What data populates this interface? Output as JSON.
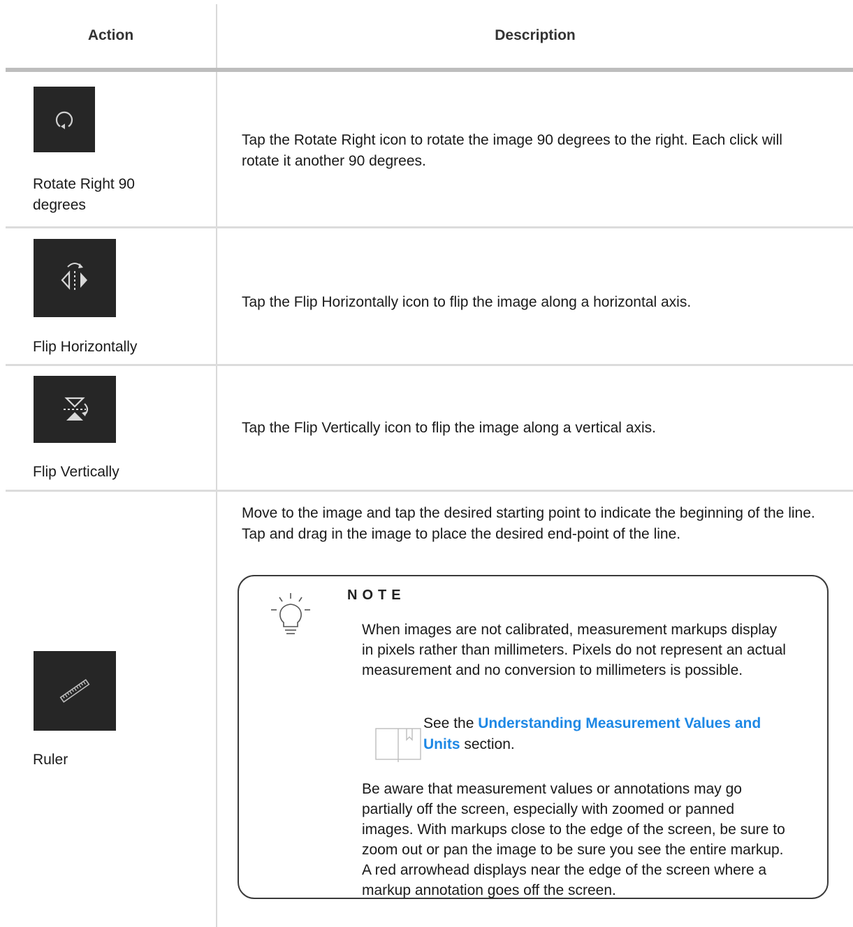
{
  "table": {
    "headers": {
      "action": "Action",
      "description": "Description"
    },
    "rows": [
      {
        "icon": "rotate-right-icon",
        "action_label": "Rotate Right 90 degrees",
        "description": "Tap the Rotate Right icon to rotate the image 90 degrees to the right. Each click will rotate it another 90 degrees."
      },
      {
        "icon": "flip-horizontal-icon",
        "action_label": "Flip Horizontally",
        "description": "Tap the Flip Horizontally icon to flip the image along a horizontal axis."
      },
      {
        "icon": "flip-vertical-icon",
        "action_label": "Flip Vertically",
        "description": "Tap the Flip Vertically icon to flip the image along a vertical axis."
      },
      {
        "icon": "ruler-icon",
        "action_label": "Ruler",
        "description": "Move to the image and tap the desired starting point to indicate the beginning of the line. Tap and drag in the image to place the desired end-point of the line."
      }
    ]
  },
  "note": {
    "title": "NOTE",
    "icon": "lightbulb-icon",
    "paragraph1": "When images are not calibrated, measurement markups display in pixels rather than millimeters. Pixels do not represent an actual measurement and no conversion to millimeters is possible.",
    "see_prefix": "See the ",
    "see_link": "Understanding Measurement Values and Units",
    "see_suffix": " section.",
    "see_icon": "book-icon",
    "paragraph2": "Be aware that measurement values or annotations may go partially off the screen, especially with zoomed or panned images. With markups close to the edge of the screen, be sure to zoom out or pan the image to be sure you see the entire markup. A red arrowhead displays near the edge of the screen where a markup annotation goes off the screen."
  },
  "colors": {
    "icon_background": "#262626",
    "link": "#1e88e5",
    "header_rule": "#bdbdbd"
  }
}
